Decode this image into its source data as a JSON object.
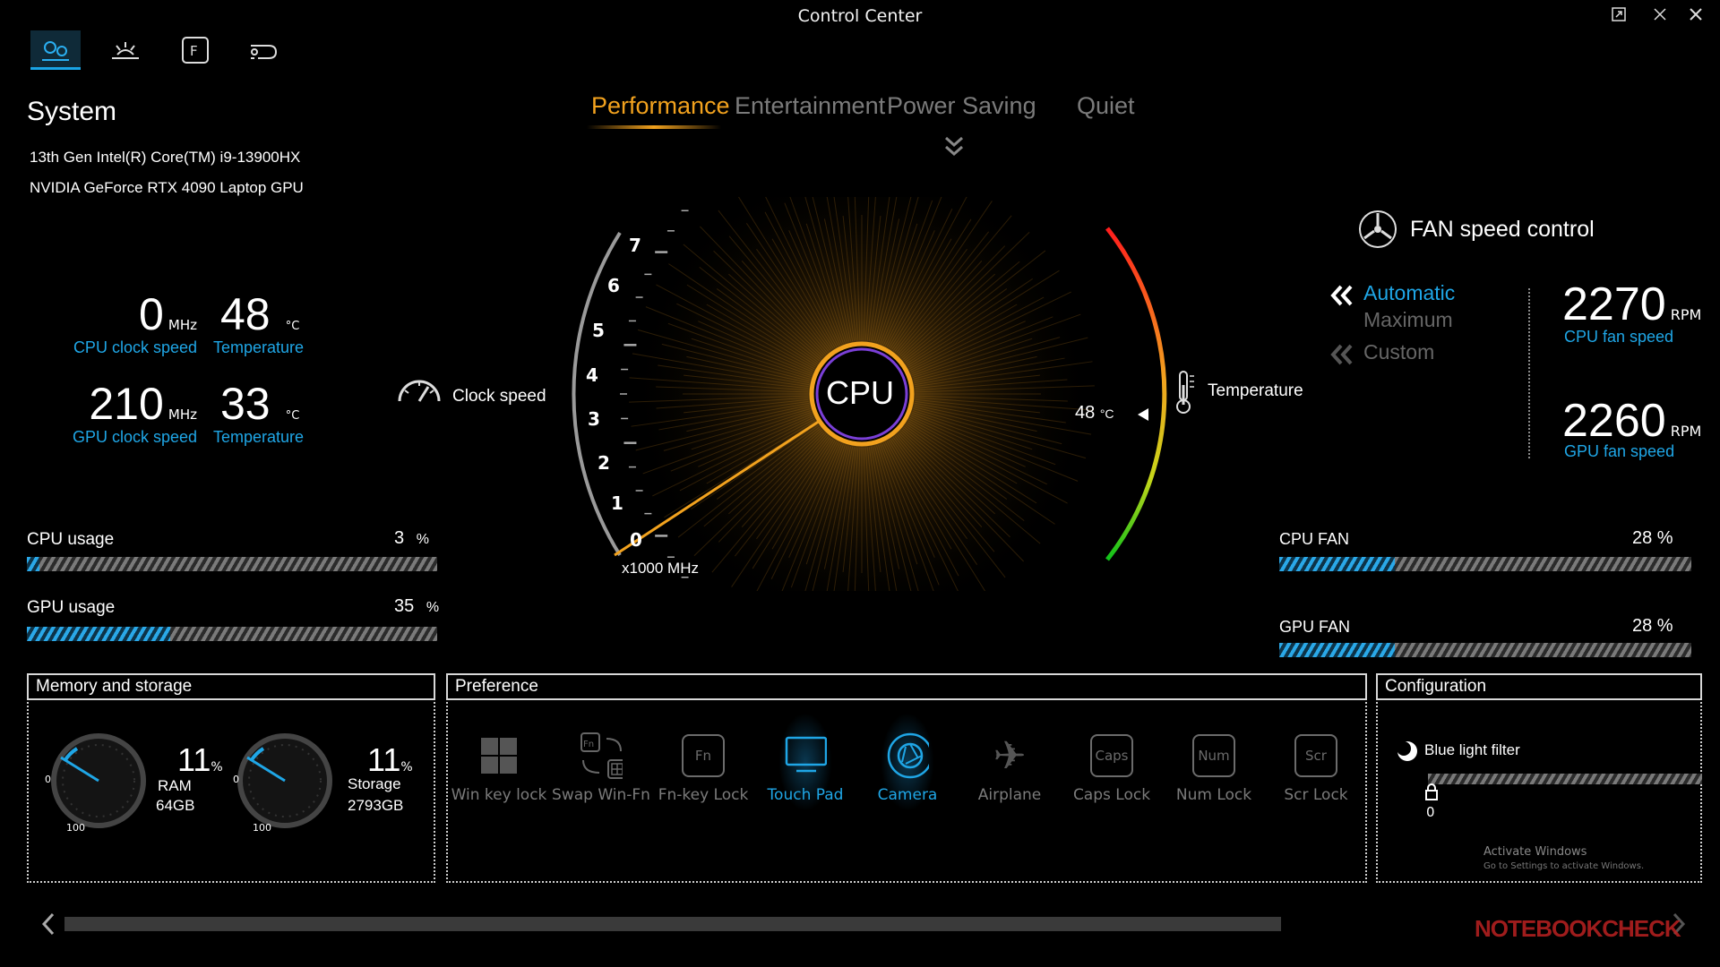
{
  "app": {
    "title": "Control Center"
  },
  "nav": {
    "tabs": [
      "system-tab",
      "brightness-tab",
      "fn-keys-tab",
      "connectivity-tab"
    ]
  },
  "system": {
    "heading": "System",
    "cpu_name": "13th Gen Intel(R) Core(TM) i9-13900HX",
    "gpu_name": "NVIDIA GeForce RTX 4090 Laptop GPU",
    "cpu_clock": "0",
    "cpu_clock_unit": "MHz",
    "cpu_clock_label": "CPU clock speed",
    "cpu_temp": "48",
    "cpu_temp_unit": "°C",
    "cpu_temp_label": "Temperature",
    "gpu_clock": "210",
    "gpu_clock_unit": "MHz",
    "gpu_clock_label": "GPU clock speed",
    "gpu_temp": "33",
    "gpu_temp_unit": "°C",
    "gpu_temp_label": "Temperature",
    "cpu_usage_label": "CPU usage",
    "cpu_usage": "3",
    "cpu_usage_unit": "%",
    "cpu_usage_value": 3,
    "gpu_usage_label": "GPU usage",
    "gpu_usage": "35",
    "gpu_usage_unit": "%",
    "gpu_usage_value": 35
  },
  "modes": {
    "items": [
      "Performance",
      "Entertainment",
      "Power Saving",
      "Quiet"
    ],
    "active": "Performance"
  },
  "gauge": {
    "center_label": "CPU",
    "clock_label": "Clock speed",
    "temp_label": "Temperature",
    "temp_value": "48",
    "temp_unit": "°C",
    "scale_unit": "x1000 MHz",
    "ticks": [
      "0",
      "1",
      "2",
      "3",
      "4",
      "5",
      "6",
      "7"
    ]
  },
  "fan": {
    "heading": "FAN speed control",
    "automatic": "Automatic",
    "maximum": "Maximum",
    "custom": "Custom",
    "cpu_rpm": "2270",
    "rpm_unit": "RPM",
    "cpu_rpm_label": "CPU fan speed",
    "gpu_rpm": "2260",
    "gpu_rpm_label": "GPU fan speed",
    "cpu_fan_label": "CPU FAN",
    "cpu_fan": "28 %",
    "cpu_fan_value": 28,
    "gpu_fan_label": "GPU FAN",
    "gpu_fan": "28 %",
    "gpu_fan_value": 28
  },
  "memory": {
    "heading": "Memory and storage",
    "ram_pct": "11",
    "pct": "%",
    "ram_label": "RAM",
    "ram_size": "64GB",
    "storage_pct": "11",
    "storage_label": "Storage",
    "storage_size": "2793GB",
    "dial_min": "0",
    "dial_max": "100"
  },
  "preference": {
    "heading": "Preference",
    "items": [
      {
        "label": "Win key lock",
        "glyph": "",
        "active": false
      },
      {
        "label": "Swap Win-Fn",
        "glyph": "Fn",
        "active": false
      },
      {
        "label": "Fn-key Lock",
        "glyph": "Fn",
        "active": false
      },
      {
        "label": "Touch Pad",
        "glyph": "",
        "active": true
      },
      {
        "label": "Camera",
        "glyph": "",
        "active": true
      },
      {
        "label": "Airplane",
        "glyph": "✈",
        "active": false
      },
      {
        "label": "Caps Lock",
        "glyph": "Caps",
        "active": false
      },
      {
        "label": "Num Lock",
        "glyph": "Num",
        "active": false
      },
      {
        "label": "Scr Lock",
        "glyph": "Scr",
        "active": false
      }
    ]
  },
  "configuration": {
    "heading": "Configuration",
    "blue_light_label": "Blue light filter",
    "blue_light_value": "0"
  },
  "watermark": {
    "line1": "Activate Windows",
    "line2": "Go to Settings to activate Windows.",
    "brand": "NOTEBOOKCHECK"
  }
}
